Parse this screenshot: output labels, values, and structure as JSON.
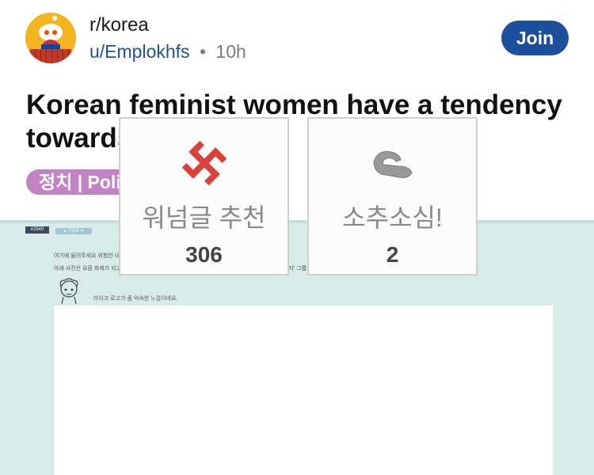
{
  "community": {
    "name": "r/korea",
    "icon": "snoo-korea-avatar"
  },
  "author": {
    "username": "u/Emplokhfs",
    "separator": "•",
    "age": "10h"
  },
  "join_label": "Join",
  "post": {
    "title": "Korean feminist women have a tendency towards Nazism",
    "flair": "정치 | Politics"
  },
  "image": {
    "post_number": "#2540",
    "chip_text": "▲ 신문보 ▼",
    "line1": "여기에 올려주세요 위험한 내용이면 삭제하겠습니다.",
    "line2": "아래 사진은 요즘 화제가 되고 있어 직접적으로 이름을 밝힐 수 없는 한필을 표적으로 삼은 '쪽품을 먹는 자' 그룹 홈페이지의 좋아요와 싫어요를 보여줍니다.",
    "line3": "라이크 로고가 좀 익숙한 느낌이네요.",
    "vote_left": {
      "icon": "swastika-icon",
      "label": "워넘글 추천",
      "count": "306"
    },
    "vote_right": {
      "icon": "pinch-hand-icon",
      "label": "소추소심!",
      "count": "2"
    }
  },
  "colors": {
    "accent": "#1c4f9c",
    "flair_bg": "#c283c5",
    "image_bg": "#d7ece8",
    "swastika": "#d9423a"
  }
}
